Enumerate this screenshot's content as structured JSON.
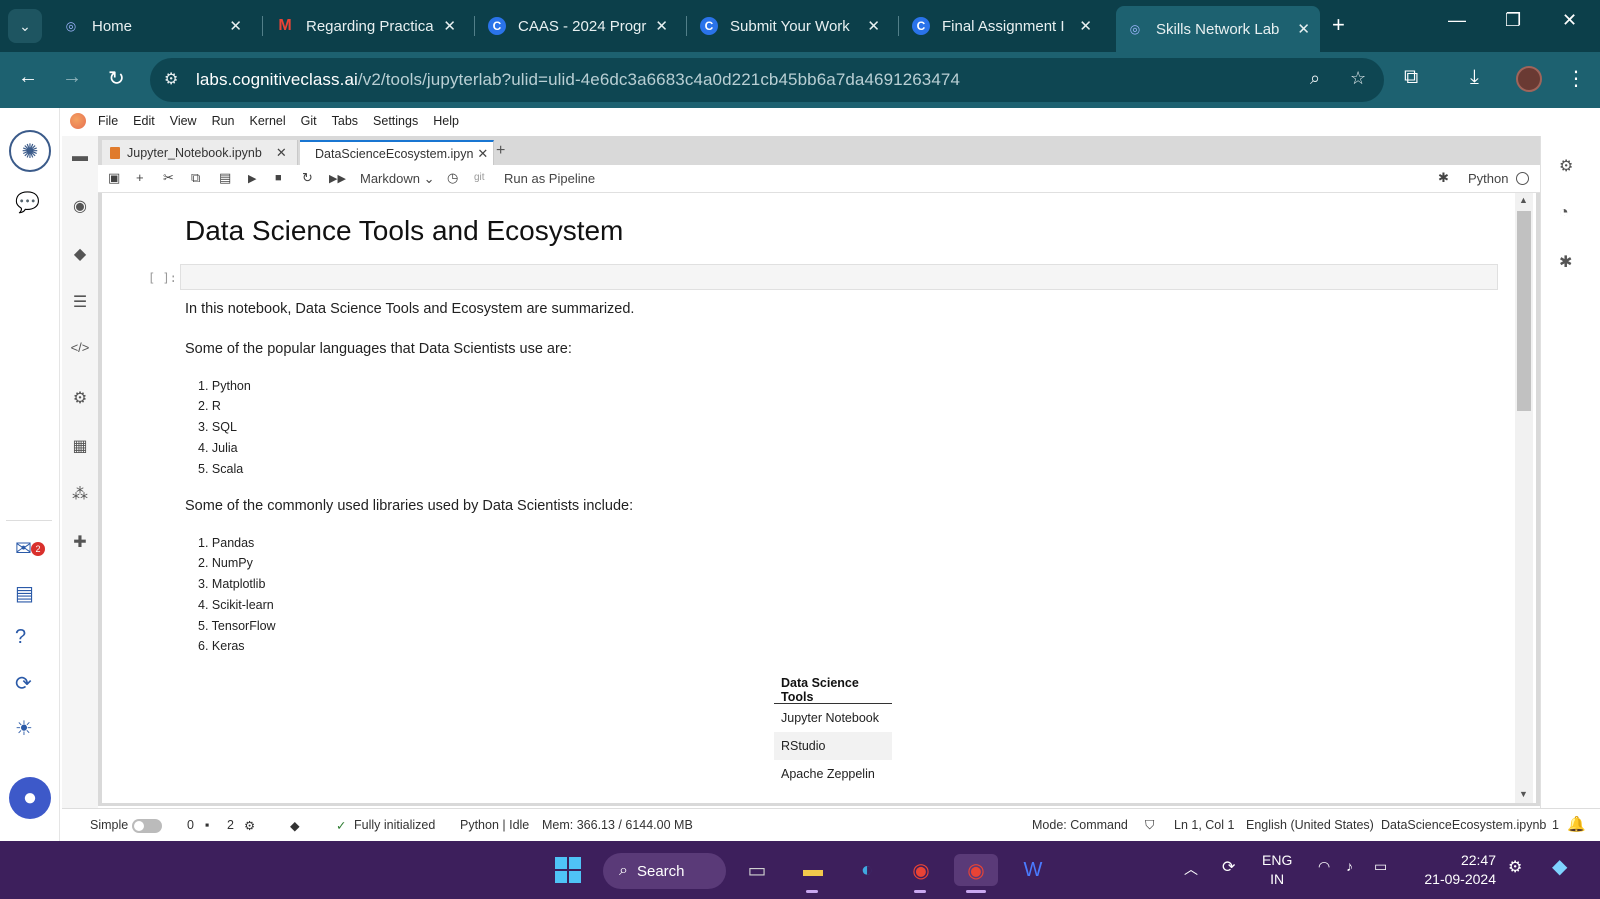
{
  "browser": {
    "tabs": [
      {
        "title": "Home",
        "favicon": "skills-network-icon"
      },
      {
        "title": "Regarding Practica",
        "favicon": "gmail-icon"
      },
      {
        "title": "CAAS - 2024 Progr",
        "favicon": "coursera-icon"
      },
      {
        "title": "Submit Your Work",
        "favicon": "coursera-icon"
      },
      {
        "title": "Final Assignment I",
        "favicon": "coursera-icon"
      },
      {
        "title": "Skills Network Lab",
        "favicon": "skills-network-icon"
      }
    ],
    "active_tab": 5,
    "url_host": "labs.cognitiveclass.ai",
    "url_path": "/v2/tools/jupyterlab?ulid=ulid-4e6dc3a6683c4a0d221cb45bb6a7da4691263474"
  },
  "menubar": [
    "File",
    "Edit",
    "View",
    "Run",
    "Kernel",
    "Git",
    "Tabs",
    "Settings",
    "Help"
  ],
  "doc_tabs": [
    {
      "label": "Jupyter_Notebook.ipynb"
    },
    {
      "label": "DataScienceEcosystem.ipyn"
    }
  ],
  "toolbar": {
    "cell_type": "Markdown",
    "git_label": "git",
    "pipeline_label": "Run as Pipeline",
    "kernel_label": "Python"
  },
  "skills_badge": "2",
  "notebook": {
    "title": "Data Science Tools and Ecosystem",
    "prompt": "[ ]:",
    "intro": "In this notebook, Data Science Tools and Ecosystem are summarized.",
    "languages_heading": "Some of the popular languages that Data Scientists use are:",
    "languages": [
      "Python",
      "R",
      "SQL",
      "Julia",
      "Scala"
    ],
    "libraries_heading": "Some of the commonly used libraries used by Data Scientists include:",
    "libraries": [
      "Pandas",
      "NumPy",
      "Matplotlib",
      "Scikit-learn",
      "TensorFlow",
      "Keras"
    ],
    "tools_table": {
      "header": "Data Science Tools",
      "rows": [
        "Jupyter Notebook",
        "RStudio",
        "Apache Zeppelin"
      ]
    }
  },
  "statusbar": {
    "mode_simple": "Simple",
    "count_a": "0",
    "count_b": "2",
    "init": "Fully initialized",
    "kernel": "Python | Idle",
    "mem": "Mem: 366.13 / 6144.00 MB",
    "mode": "Mode: Command",
    "position": "Ln 1, Col 1",
    "language": "English (United States)",
    "file": "DataScienceEcosystem.ipynb",
    "notifications": "1"
  },
  "taskbar": {
    "search_label": "Search",
    "lang_top": "ENG",
    "lang_bottom": "IN",
    "time": "22:47",
    "date": "21-09-2024"
  },
  "colors": {
    "tabstrip": "#0c3f4a",
    "navbar": "#1d6170",
    "taskbar": "#3d1f5c",
    "accent": "#1976d2"
  }
}
